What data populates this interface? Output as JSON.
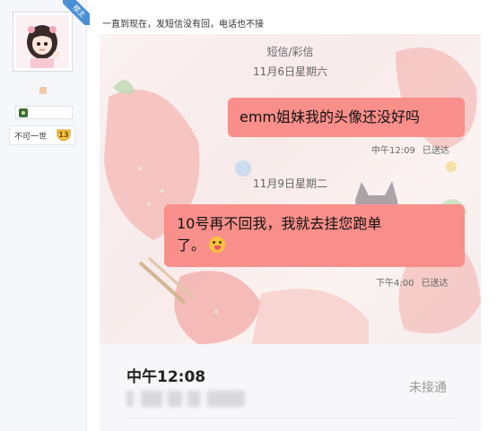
{
  "user": {
    "avatar_alt": "avatar",
    "ribbon": "楼主",
    "level_name": "不可一世",
    "level_number": "13"
  },
  "post": {
    "text": "一直到现在，发短信没有回，电话也不接"
  },
  "sms": {
    "header": "短信/彩信",
    "date1": "11月6日星期六",
    "message1": "emm姐妹我的头像还没好吗",
    "time1": "中午12:09",
    "status1": "已送达",
    "date2": "11月9日星期二",
    "message2_line1": "10号再不回我，我就去挂您跑单",
    "message2_line2": "了。",
    "time2": "下午4:00",
    "status2": "已送达"
  },
  "call": {
    "time": "中午12:08",
    "status": "未接通"
  },
  "colors": {
    "bubble": "#f98f8a",
    "ribbon": "#4a8fd6",
    "sidebar_bg": "#f5f7fa"
  }
}
